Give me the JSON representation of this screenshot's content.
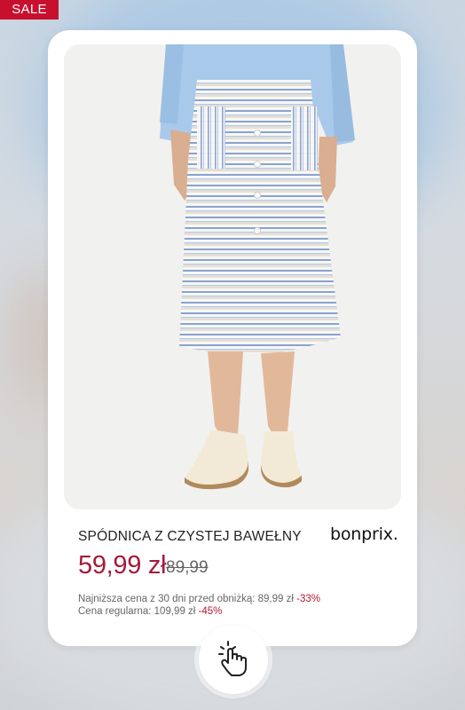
{
  "badge": {
    "label": "SALE",
    "color": "#c8102e"
  },
  "product": {
    "image_icon": "striped-skirt-photo",
    "title": "SPÓDNICA Z CZYSTEJ BAWEŁNY",
    "brand": "bonprix.",
    "price_current": "59,99 zł",
    "price_old": "89,99",
    "lowest_price_text": "Najniższa cena z 30 dni przed obniżką: 89,99 zł",
    "lowest_price_discount": "-33%",
    "regular_price_text": "Cena regularna: 109,99 zł",
    "regular_price_discount": "-45%"
  },
  "cta": {
    "icon": "tap-hand-icon"
  },
  "colors": {
    "accent": "#a41b3a",
    "discount": "#b31830"
  }
}
